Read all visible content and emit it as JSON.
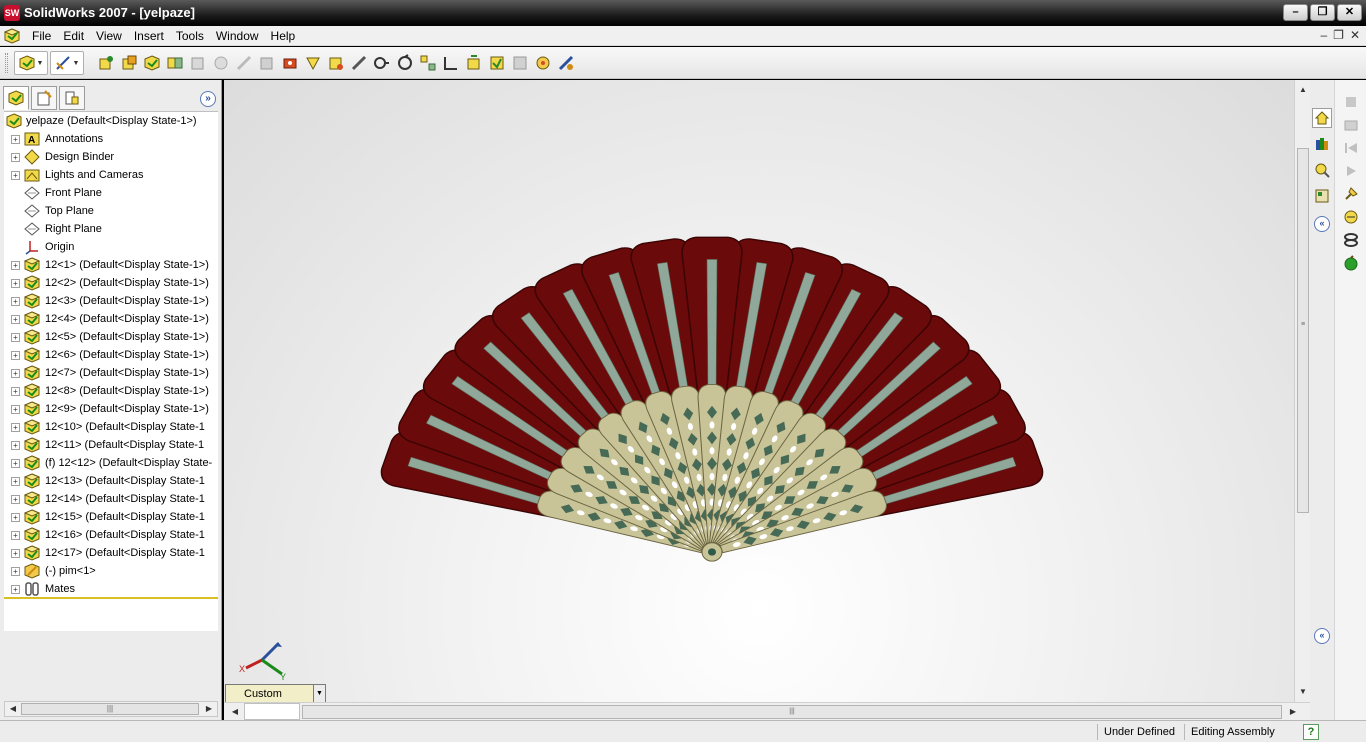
{
  "window": {
    "title": "SolidWorks 2007 - [yelpaze]",
    "app_icon_text": "SW"
  },
  "menu": {
    "items": [
      "File",
      "Edit",
      "View",
      "Insert",
      "Tools",
      "Window",
      "Help"
    ]
  },
  "tree": {
    "root_label": "yelpaze  (Default<Display State-1>)",
    "items": [
      {
        "label": "Annotations",
        "icon": "annotations-icon",
        "expandable": true
      },
      {
        "label": "Design Binder",
        "icon": "design-binder-icon",
        "expandable": true
      },
      {
        "label": "Lights and Cameras",
        "icon": "lights-cameras-icon",
        "expandable": true
      },
      {
        "label": "Front Plane",
        "icon": "plane-icon",
        "expandable": false
      },
      {
        "label": "Top Plane",
        "icon": "plane-icon",
        "expandable": false
      },
      {
        "label": "Right Plane",
        "icon": "plane-icon",
        "expandable": false
      },
      {
        "label": "Origin",
        "icon": "origin-icon",
        "expandable": false
      },
      {
        "label": "12<1> (Default<Display State-1>)",
        "icon": "part-icon",
        "expandable": true
      },
      {
        "label": "12<2> (Default<Display State-1>)",
        "icon": "part-icon",
        "expandable": true
      },
      {
        "label": "12<3> (Default<Display State-1>)",
        "icon": "part-icon",
        "expandable": true
      },
      {
        "label": "12<4> (Default<Display State-1>)",
        "icon": "part-icon",
        "expandable": true
      },
      {
        "label": "12<5> (Default<Display State-1>)",
        "icon": "part-icon",
        "expandable": true
      },
      {
        "label": "12<6> (Default<Display State-1>)",
        "icon": "part-icon",
        "expandable": true
      },
      {
        "label": "12<7> (Default<Display State-1>)",
        "icon": "part-icon",
        "expandable": true
      },
      {
        "label": "12<8> (Default<Display State-1>)",
        "icon": "part-icon",
        "expandable": true
      },
      {
        "label": "12<9> (Default<Display State-1>)",
        "icon": "part-icon",
        "expandable": true
      },
      {
        "label": "12<10> (Default<Display State-1",
        "icon": "part-icon",
        "expandable": true
      },
      {
        "label": "12<11> (Default<Display State-1",
        "icon": "part-icon",
        "expandable": true
      },
      {
        "label": "(f) 12<12> (Default<Display State-",
        "icon": "part-icon",
        "expandable": true
      },
      {
        "label": "12<13> (Default<Display State-1",
        "icon": "part-icon",
        "expandable": true
      },
      {
        "label": "12<14> (Default<Display State-1",
        "icon": "part-icon",
        "expandable": true
      },
      {
        "label": "12<15> (Default<Display State-1",
        "icon": "part-icon",
        "expandable": true
      },
      {
        "label": "12<16> (Default<Display State-1",
        "icon": "part-icon",
        "expandable": true
      },
      {
        "label": "12<17> (Default<Display State-1",
        "icon": "part-icon",
        "expandable": true
      },
      {
        "label": "(-) pim<1>",
        "icon": "pin-part-icon",
        "expandable": true
      },
      {
        "label": "Mates",
        "icon": "mates-icon",
        "expandable": true
      }
    ]
  },
  "view": {
    "orientation": "Custom",
    "triad_labels": {
      "x": "X",
      "y": "Y"
    }
  },
  "model": {
    "name": "yelpaze",
    "blade_count": 17,
    "colors": {
      "blade_outer": "#6b0a0a",
      "blade_edge": "#3a0404",
      "blade_inner": "#c9c398",
      "blade_inner_edge": "#6a6440",
      "slot": "#8fa89a",
      "pattern": "#2f5a4a"
    }
  },
  "status": {
    "state": "Under Defined",
    "mode": "Editing Assembly"
  }
}
